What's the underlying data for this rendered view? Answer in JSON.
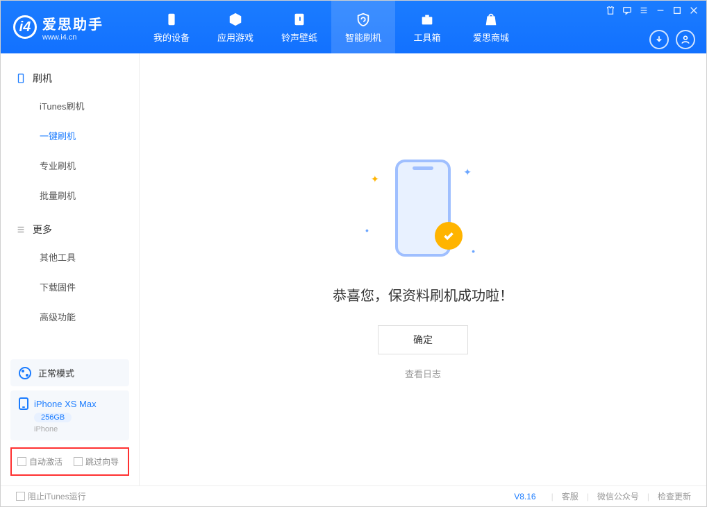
{
  "app": {
    "title": "爱思助手",
    "subtitle": "www.i4.cn"
  },
  "nav": {
    "tabs": [
      {
        "label": "我的设备"
      },
      {
        "label": "应用游戏"
      },
      {
        "label": "铃声壁纸"
      },
      {
        "label": "智能刷机"
      },
      {
        "label": "工具箱"
      },
      {
        "label": "爱思商城"
      }
    ]
  },
  "sidebar": {
    "section1": {
      "title": "刷机",
      "items": [
        "iTunes刷机",
        "一键刷机",
        "专业刷机",
        "批量刷机"
      ]
    },
    "section2": {
      "title": "更多",
      "items": [
        "其他工具",
        "下载固件",
        "高级功能"
      ]
    },
    "mode": "正常模式",
    "device": {
      "name": "iPhone XS Max",
      "capacity": "256GB",
      "type": "iPhone"
    },
    "checkboxes": {
      "auto_activate": "自动激活",
      "skip_guide": "跳过向导"
    }
  },
  "main": {
    "success_text": "恭喜您，保资料刷机成功啦！",
    "ok_button": "确定",
    "view_log": "查看日志"
  },
  "footer": {
    "block_itunes": "阻止iTunes运行",
    "version": "V8.16",
    "links": [
      "客服",
      "微信公众号",
      "检查更新"
    ]
  }
}
